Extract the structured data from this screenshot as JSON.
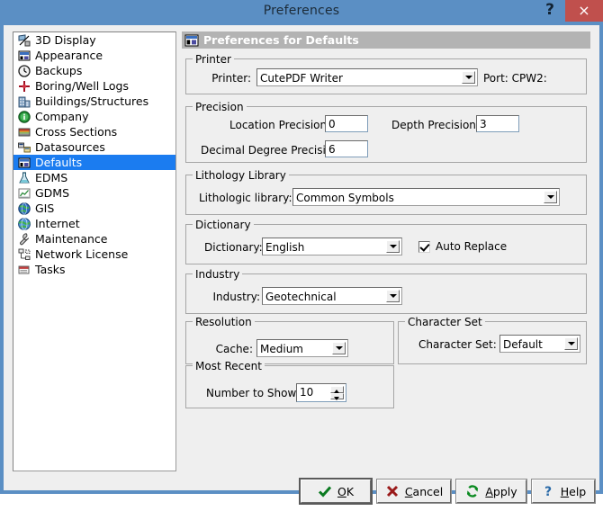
{
  "window": {
    "title": "Preferences",
    "help_glyph": "?",
    "close_glyph": "×",
    "titlebar_color": "#5b8fc4",
    "close_color": "#c0504d",
    "body_color": "#efefef",
    "selection_color": "#1b7cf0"
  },
  "sidebar": {
    "items": [
      {
        "label": "3D Display",
        "icon": "3d-display-icon",
        "selected": false
      },
      {
        "label": "Appearance",
        "icon": "appearance-icon",
        "selected": false
      },
      {
        "label": "Backups",
        "icon": "clock-icon",
        "selected": false
      },
      {
        "label": "Boring/Well Logs",
        "icon": "boring-marker-icon",
        "selected": false
      },
      {
        "label": "Buildings/Structures",
        "icon": "buildings-icon",
        "selected": false
      },
      {
        "label": "Company",
        "icon": "company-info-icon",
        "selected": false
      },
      {
        "label": "Cross Sections",
        "icon": "cross-sections-icon",
        "selected": false
      },
      {
        "label": "Datasources",
        "icon": "datasources-icon",
        "selected": false
      },
      {
        "label": "Defaults",
        "icon": "defaults-icon",
        "selected": true
      },
      {
        "label": "EDMS",
        "icon": "flask-icon",
        "selected": false
      },
      {
        "label": "GDMS",
        "icon": "chart-icon",
        "selected": false
      },
      {
        "label": "GIS",
        "icon": "globe-icon",
        "selected": false
      },
      {
        "label": "Internet",
        "icon": "internet-globe-icon",
        "selected": false
      },
      {
        "label": "Maintenance",
        "icon": "wrench-icon",
        "selected": false
      },
      {
        "label": "Network License",
        "icon": "network-license-icon",
        "selected": false
      },
      {
        "label": "Tasks",
        "icon": "tasks-icon",
        "selected": false
      }
    ]
  },
  "panel": {
    "header": "Preferences for Defaults",
    "header_icon": "defaults-icon",
    "groups": {
      "printer": {
        "legend": "Printer",
        "printer_label": "Printer:",
        "printer_value": "CutePDF Writer",
        "port_text": "Port: CPW2:"
      },
      "precision": {
        "legend": "Precision",
        "location_label": "Location Precision:",
        "location_value": "0",
        "depth_label": "Depth Precision:",
        "depth_value": "3",
        "decimal_label": "Decimal Degree Precision:",
        "decimal_value": "6"
      },
      "lithology": {
        "legend": "Lithology Library",
        "library_label": "Lithologic library:",
        "library_value": "Common Symbols"
      },
      "dictionary": {
        "legend": "Dictionary",
        "dictionary_label": "Dictionary:",
        "dictionary_value": "English",
        "auto_replace_label": "Auto Replace",
        "auto_replace_checked": true
      },
      "industry": {
        "legend": "Industry",
        "industry_label": "Industry:",
        "industry_value": "Geotechnical"
      },
      "resolution": {
        "legend": "Resolution",
        "cache_label": "Cache:",
        "cache_value": "Medium"
      },
      "character_set": {
        "legend": "Character Set",
        "charset_label": "Character Set:",
        "charset_value": "Default"
      },
      "most_recent": {
        "legend": "Most Recent",
        "number_label": "Number to Show:",
        "number_value": "10"
      }
    }
  },
  "footer": {
    "buttons": [
      {
        "label": "OK",
        "accel": "O",
        "icon": "check-icon"
      },
      {
        "label": "Cancel",
        "accel": "C",
        "icon": "x-icon"
      },
      {
        "label": "Apply",
        "accel": "A",
        "icon": "refresh-icon"
      },
      {
        "label": "Help",
        "accel": "H",
        "icon": "question-icon"
      }
    ]
  }
}
